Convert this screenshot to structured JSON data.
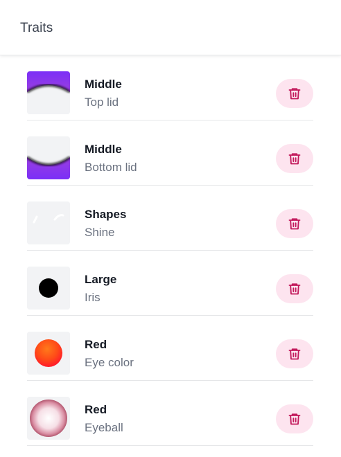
{
  "header": {
    "title": "Traits"
  },
  "traits": [
    {
      "name": "Middle",
      "category": "Top lid",
      "icon": "top-lid-icon"
    },
    {
      "name": "Middle",
      "category": "Bottom lid",
      "icon": "bottom-lid-icon"
    },
    {
      "name": "Shapes",
      "category": "Shine",
      "icon": "shine-icon"
    },
    {
      "name": "Large",
      "category": "Iris",
      "icon": "iris-icon"
    },
    {
      "name": "Red",
      "category": "Eye color",
      "icon": "eye-color-icon"
    },
    {
      "name": "Red",
      "category": "Eyeball",
      "icon": "eyeball-icon"
    }
  ],
  "colors": {
    "lid_purple": "#8a2be2",
    "delete_bg": "#fde4ef",
    "delete_icon": "#c2185b",
    "eye_color_red": "#ff3b1f"
  }
}
